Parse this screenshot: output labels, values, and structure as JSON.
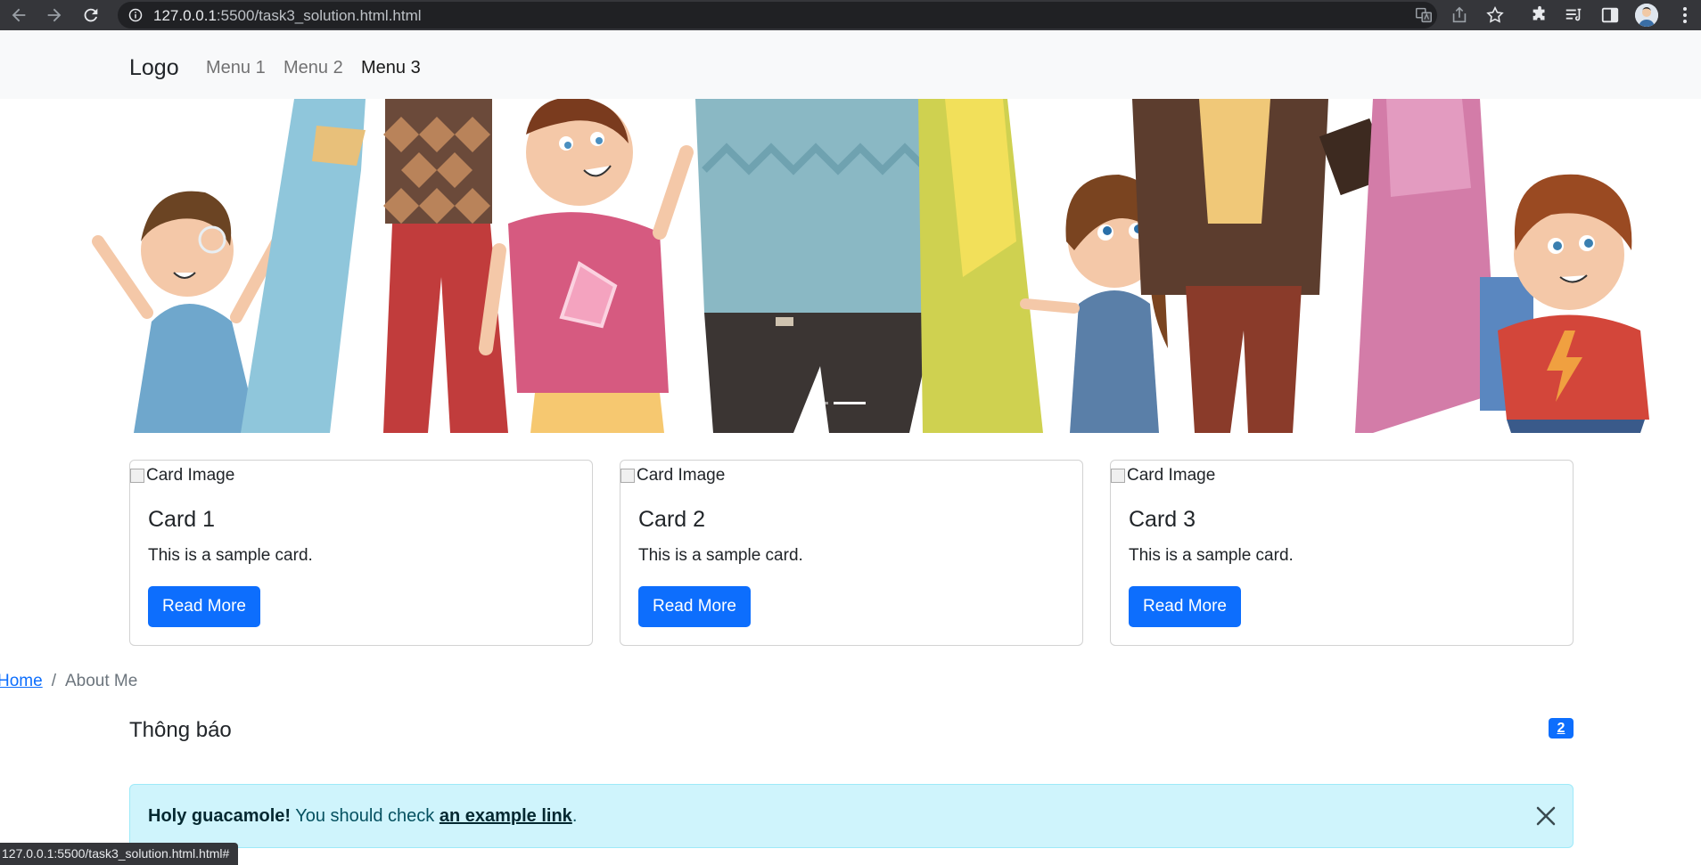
{
  "browser": {
    "url_host": "127.0.0.1",
    "url_rest": ":5500/task3_solution.html.html",
    "status_url": "127.0.0.1:5500/task3_solution.html.html#"
  },
  "navbar": {
    "brand": "Logo",
    "menu": [
      {
        "label": "Menu 1"
      },
      {
        "label": "Menu 2"
      },
      {
        "label": "Menu 3"
      }
    ]
  },
  "carousel": {
    "active_slide": 2,
    "slide_count": 2
  },
  "cards": [
    {
      "image_alt": "Card Image",
      "title": "Card 1",
      "text": "This is a sample card.",
      "button": "Read More"
    },
    {
      "image_alt": "Card Image",
      "title": "Card 2",
      "text": "This is a sample card.",
      "button": "Read More"
    },
    {
      "image_alt": "Card Image",
      "title": "Card 3",
      "text": "This is a sample card.",
      "button": "Read More"
    }
  ],
  "breadcrumb": {
    "home": "Home",
    "separator": "/",
    "current": "About Me"
  },
  "notifications": {
    "title": "Thông báo",
    "badge": "2"
  },
  "alert": {
    "strong": "Holy guacamole!",
    "text": " You should check ",
    "link": "an example link",
    "end": "."
  },
  "colors": {
    "primary": "#0d6efd",
    "alert_bg": "#cff4fc",
    "navbar_bg": "#f8f9fa"
  }
}
